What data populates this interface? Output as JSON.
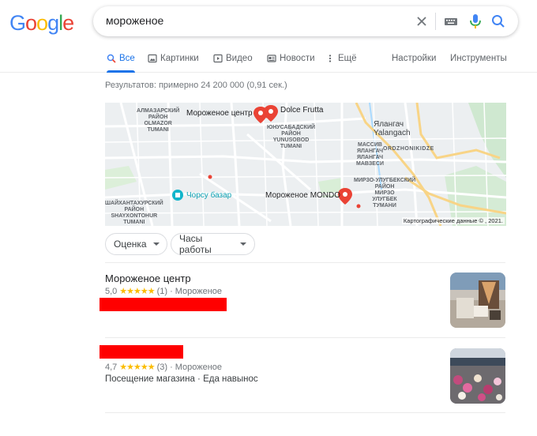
{
  "logo": {
    "letters": [
      "G",
      "o",
      "o",
      "g",
      "l",
      "e"
    ],
    "colors": [
      "#4285f4",
      "#ea4335",
      "#fbbc05",
      "#4285f4",
      "#34a853",
      "#ea4335"
    ]
  },
  "search": {
    "query": "мороженое"
  },
  "tabs": {
    "all": "Все",
    "images": "Картинки",
    "video": "Видео",
    "news": "Новости",
    "more": "Ещё",
    "settings": "Настройки",
    "tools": "Инструменты"
  },
  "result_stats": "Результатов: примерно 24 200 000 (0,91 сек.)",
  "map": {
    "labels": {
      "almazar": "АЛМАЗАРСКИЙ\nРАЙОН\nOLMAZOR\nTUMANI",
      "yunusabad": "ЮНУСАБАДСКИЙ\nРАЙОН\nYUNUSOBOD\nTUMANI",
      "massiv": "МАССИВ\nЯЛАНГАЧ\nЯЛАНГАЧ\nМАВЗЕСИ",
      "ordzhonikidze": "ORDZHONIKIDZE",
      "yalangach": "Ялангач\nYalangach",
      "mirzo": "МИРЗО-УЛУГБЕКСКИЙ\nРАЙОН\nМИРЗО\nУЛУГБЕК\nТУМАНИ",
      "shaykhantakhur": "ШАЙХАНТАХУРСКИЙ\nРАЙОН\nSHAYXONTOHUR\nTUMANI"
    },
    "places": {
      "center": "Мороженое центр",
      "dolce": "Dolce Frutta",
      "chorsu": "Чорсу базар",
      "mondo": "Мороженое MONDO"
    },
    "attribution": "Картографические данные © , 2021."
  },
  "chips": {
    "rating": "Оценка",
    "hours": "Часы работы"
  },
  "results": [
    {
      "title": "Мороженое центр",
      "rating": "5,0",
      "stars": "★★★★★",
      "reviews": "(1)",
      "category": "Мороженое"
    },
    {
      "rating": "4,7",
      "stars": "★★★★★",
      "reviews": "(3)",
      "category": "Мороженое",
      "info": "Посещение магазина · Еда навынос"
    }
  ],
  "separator": "·",
  "colors": {
    "accent": "#1a73e8",
    "star": "#fbbc04",
    "redaction": "#ff0000",
    "pin": "#ea4335"
  }
}
